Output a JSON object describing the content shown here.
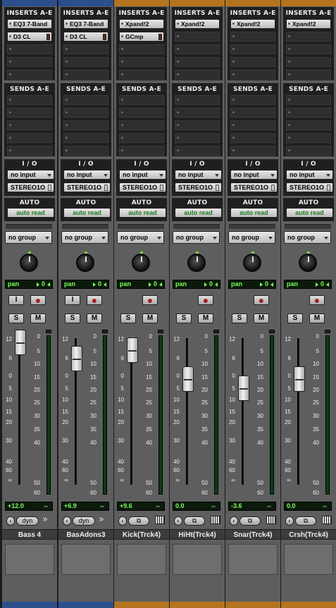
{
  "section_labels": {
    "inserts": "INSERTS A-E",
    "sends": "SENDS A-E",
    "io": "I / O",
    "auto": "AUTO"
  },
  "colors": {
    "blue_track": "#2c4f8c",
    "orange_track": "#b5731f",
    "pan_text": "#7cff5a",
    "auto_text": "#1f7a1f"
  },
  "fader_scale_left": [
    "12",
    "6",
    "0",
    "5",
    "10",
    "15",
    "20",
    "30",
    "40",
    "60",
    "∞"
  ],
  "meter_scale_right": [
    "0",
    "5",
    "10",
    "15",
    "20",
    "25",
    "30",
    "35",
    "40",
    "50",
    "60"
  ],
  "strips": [
    {
      "name": "Bass 4",
      "color": "#2c4f8c",
      "inserts": [
        "EQ3 7-Band",
        "D3 CL"
      ],
      "input": "no input",
      "output": "STEREO1O",
      "auto": "auto read",
      "group": "no group",
      "pan_label": "pan",
      "pan_value": "0",
      "volume": "+12.0",
      "fader_db": 12.0,
      "has_input_btn": true,
      "bottom_btn": "dyn",
      "bottom_icon": "double-arrow-icon"
    },
    {
      "name": "BasAdons3",
      "color": "#2c4f8c",
      "inserts": [
        "EQ3 7-Band",
        "D3 CL"
      ],
      "input": "no input",
      "output": "STEREO1O",
      "auto": "auto read",
      "group": "no group",
      "pan_label": "pan",
      "pan_value": "0",
      "volume": "+6.9",
      "fader_db": 6.9,
      "has_input_btn": true,
      "bottom_btn": "dyn",
      "bottom_icon": "double-arrow-icon"
    },
    {
      "name": "Kick(Trck4)",
      "color": "#b5731f",
      "inserts": [
        "Xpand!2",
        "GCmp"
      ],
      "input": "no input",
      "output": "STEREO1O",
      "auto": "auto read",
      "group": "no group",
      "pan_label": "pan",
      "pan_value": "0",
      "volume": "+9.6",
      "fader_db": 9.6,
      "has_input_btn": false,
      "bottom_btn": "",
      "bottom_icon": "piano-icon"
    },
    {
      "name": "HiHt(Trck4)",
      "color": "#b5731f",
      "inserts": [
        "Xpand!2"
      ],
      "input": "no input",
      "output": "STEREO1O",
      "auto": "auto read",
      "group": "no group",
      "pan_label": "pan",
      "pan_value": "0",
      "volume": "0.0",
      "fader_db": 0.0,
      "has_input_btn": false,
      "bottom_btn": "",
      "bottom_icon": "piano-icon"
    },
    {
      "name": "Snar(Trck4)",
      "color": "#b5731f",
      "inserts": [
        "Xpand!2"
      ],
      "input": "no input",
      "output": "STEREO1O",
      "auto": "auto read",
      "group": "no group",
      "pan_label": "pan",
      "pan_value": "0",
      "volume": "-3.6",
      "fader_db": -3.6,
      "has_input_btn": false,
      "bottom_btn": "",
      "bottom_icon": "piano-icon"
    },
    {
      "name": "Crsh(Trck4)",
      "color": "#b5731f",
      "inserts": [
        "Xpand!2"
      ],
      "input": "no input",
      "output": "STEREO1O",
      "auto": "auto read",
      "group": "no group",
      "pan_label": "pan",
      "pan_value": "0",
      "volume": "0.0",
      "fader_db": 0.0,
      "has_input_btn": false,
      "bottom_btn": "",
      "bottom_icon": "piano-icon"
    }
  ]
}
